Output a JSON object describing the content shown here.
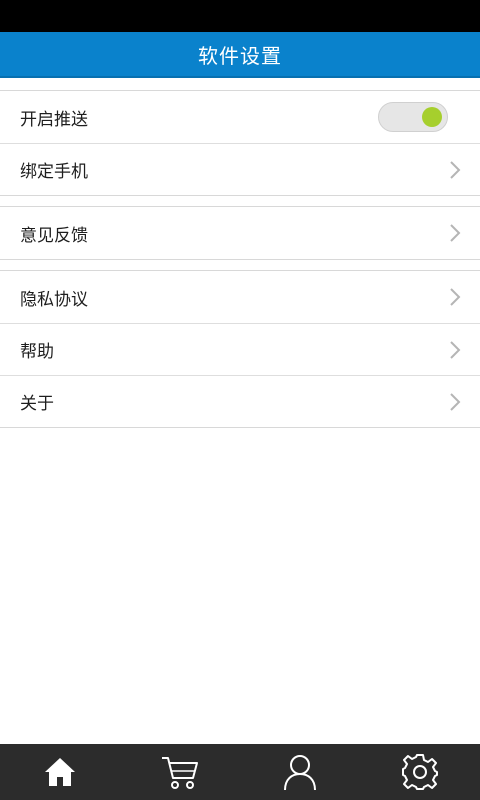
{
  "header": {
    "title": "软件设置"
  },
  "groups": [
    {
      "items": [
        {
          "label": "开启推送",
          "control": "toggle",
          "toggle_on": true
        },
        {
          "label": "绑定手机",
          "control": "chevron"
        }
      ]
    },
    {
      "items": [
        {
          "label": "意见反馈",
          "control": "chevron"
        }
      ]
    },
    {
      "items": [
        {
          "label": "隐私协议",
          "control": "chevron"
        },
        {
          "label": "帮助",
          "control": "chevron"
        },
        {
          "label": "关于",
          "control": "chevron"
        }
      ]
    }
  ],
  "tab_bar": {
    "tabs": [
      {
        "icon": "home-icon"
      },
      {
        "icon": "cart-icon"
      },
      {
        "icon": "user-icon"
      },
      {
        "icon": "gear-icon"
      }
    ]
  },
  "colors": {
    "header_background": "#0a82cc",
    "toggle_knob": "#a6cf2d",
    "tab_bar_background": "#2c2c2c"
  }
}
